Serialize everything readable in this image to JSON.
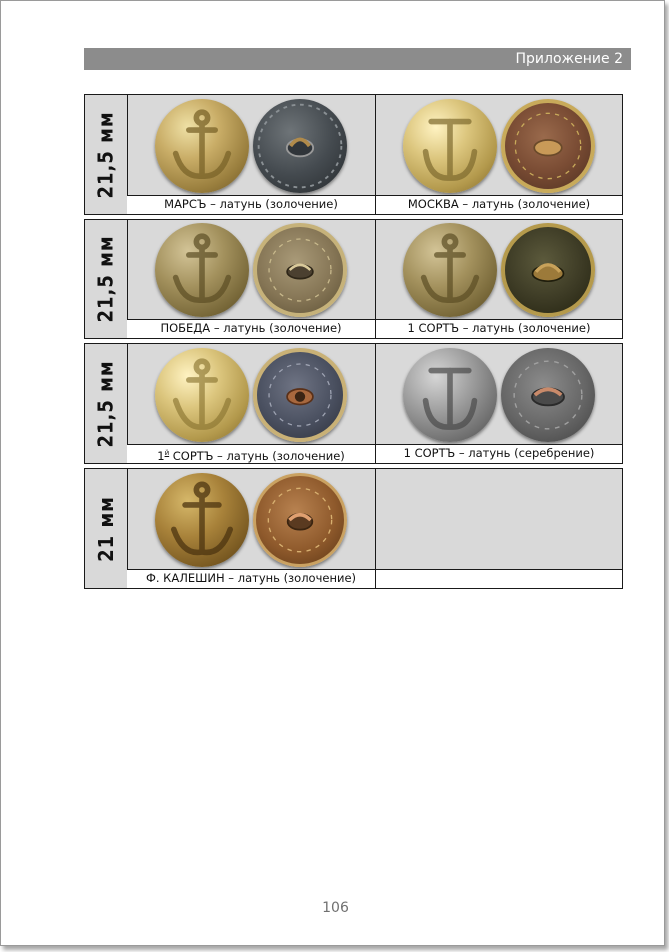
{
  "header": {
    "title": "Приложение 2"
  },
  "groups": [
    {
      "size": "21,5 мм",
      "items": [
        {
          "caption": "МАРСЪ – латунь (золочение)",
          "front_icon": "anchor-icon",
          "back_icon": "shank-icon"
        },
        {
          "caption": "МОСКВА – латунь (золочение)",
          "front_icon": "anchor-icon",
          "back_icon": "shank-icon"
        }
      ]
    },
    {
      "size": "21,5 мм",
      "items": [
        {
          "caption": "ПОБЕДА – латунь (золочение)",
          "front_icon": "anchor-icon",
          "back_icon": "shank-icon"
        },
        {
          "caption": "1 СОРТЪ – латунь (золочение)",
          "front_icon": "anchor-icon",
          "back_icon": "shank-icon"
        }
      ]
    },
    {
      "size": "21,5 мм",
      "items": [
        {
          "caption_prefix": "1",
          "caption_sup": "й",
          "caption_rest": " СОРТЪ – латунь (золочение)",
          "front_icon": "anchor-icon",
          "back_icon": "shank-icon"
        },
        {
          "caption": "1 СОРТЪ – латунь (серебрение)",
          "front_icon": "anchor-icon",
          "back_icon": "shank-icon"
        }
      ]
    },
    {
      "size": "21 мм",
      "items": [
        {
          "caption": "Ф. КАЛЕШИН – латунь (золочение)",
          "front_icon": "anchor-icon",
          "back_icon": "shank-icon"
        }
      ]
    }
  ],
  "footer": {
    "page_number": "106"
  }
}
